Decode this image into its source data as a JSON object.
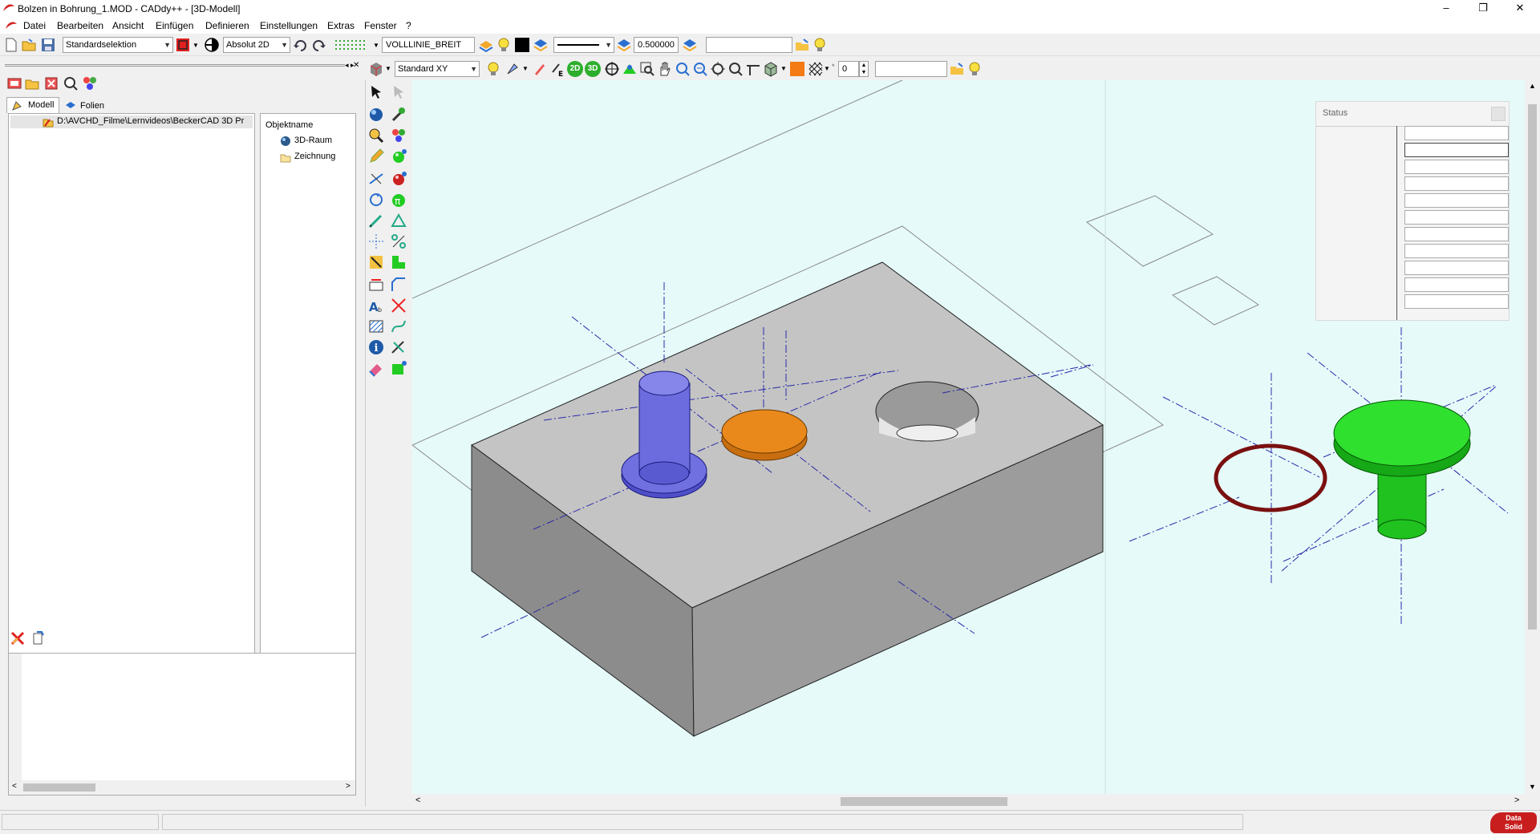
{
  "window": {
    "title": "Bolzen in Bohrung_1.MOD  -  CADdy++ - [3D-Modell]",
    "controls": {
      "minimize": "–",
      "restore": "❐",
      "close": "✕"
    }
  },
  "menu": [
    "Datei",
    "Bearbeiten",
    "Ansicht",
    "Einfügen",
    "Definieren",
    "Einstellungen",
    "Extras",
    "Fenster",
    "?"
  ],
  "toolbar1": {
    "selection_mode": "Standardselektion",
    "coord_mode": "Absolut 2D",
    "line_type": "VOLLLINIE_BREIT",
    "line_width": "0.500000",
    "extra_field": ""
  },
  "toolbar2": {
    "view_plane": "Standard XY",
    "layer_value": "0",
    "extra_field": "",
    "btn_2d": "2D",
    "btn_3d": "3D"
  },
  "left_panel": {
    "tabs": [
      "Modell",
      "Folien"
    ],
    "path": "D:\\AVCHD_Filme\\Lernvideos\\BeckerCAD 3D Pr",
    "objects_header": "Objektname",
    "objects": [
      "3D-Raum",
      "Zeichnung"
    ]
  },
  "status_panel": {
    "title": "Status"
  },
  "brand": {
    "logo_top": "Data",
    "logo_bottom": "Solid"
  },
  "colors": {
    "viewport_bg": "#e6fafa",
    "block_top": "#c4c4c4",
    "pin_blue": "#6c6cde",
    "pin_orange": "#e9891c",
    "pin_green": "#1fd21f",
    "ring_red": "#7a1010",
    "axis_blue": "#2a2aa8"
  }
}
